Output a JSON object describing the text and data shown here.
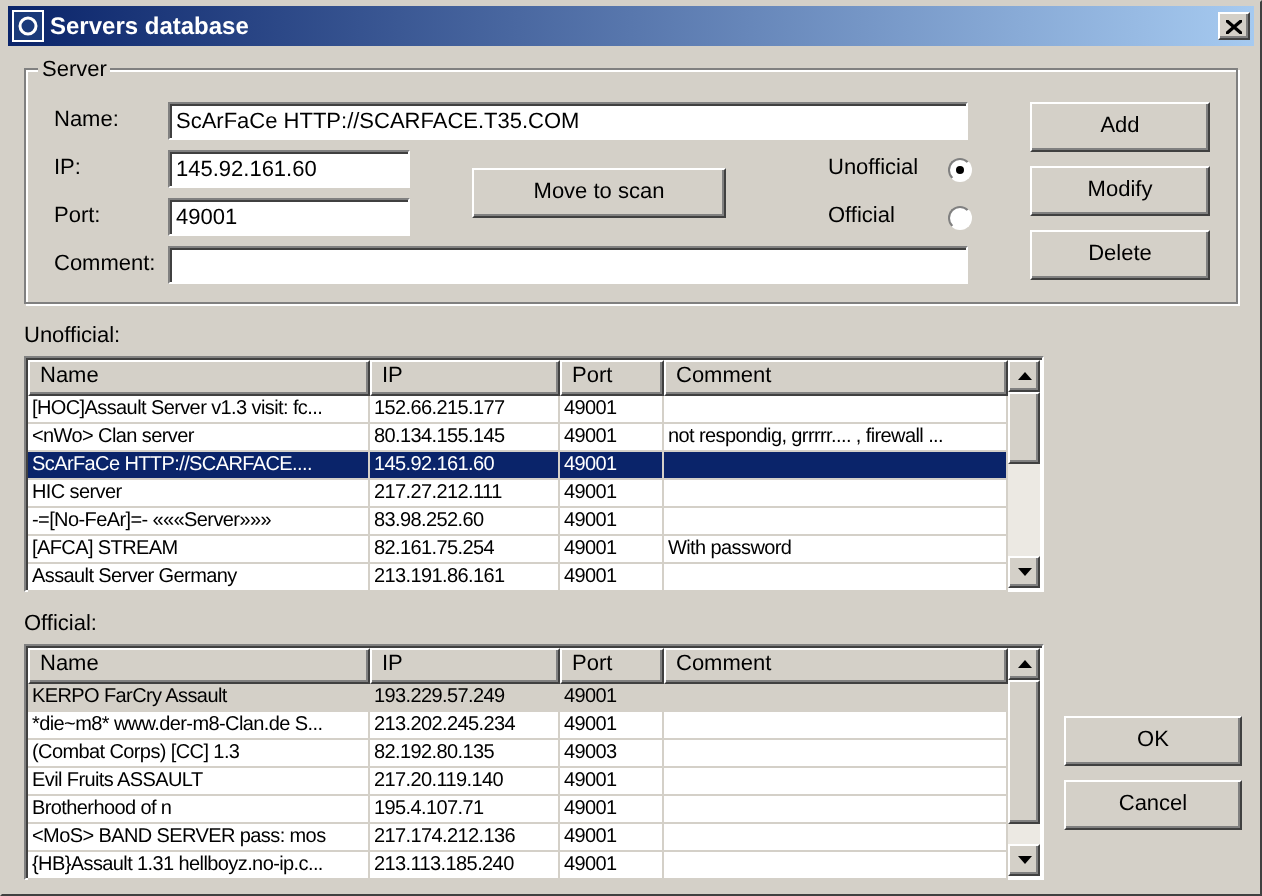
{
  "window": {
    "title": "Servers database"
  },
  "server": {
    "legend": "Server",
    "name_label": "Name:",
    "name_value": "ScArFaCe HTTP://SCARFACE.T35.COM",
    "ip_label": "IP:",
    "ip_value": "145.92.161.60",
    "port_label": "Port:",
    "port_value": "49001",
    "comment_label": "Comment:",
    "move_button": "Move to scan",
    "types": [
      {
        "label": "Unofficial",
        "selected": true
      },
      {
        "label": "Official",
        "selected": false
      }
    ]
  },
  "side_buttons": [
    "Add",
    "Modify",
    "Delete"
  ],
  "lists": [
    {
      "label": "Unofficial:",
      "columns": [
        "Name",
        "IP",
        "Port",
        "Comment"
      ],
      "focused": true,
      "rows": [
        {
          "cells": [
            "[HOC]Assault Server v1.3 visit: fc...",
            "152.66.215.177",
            "49001",
            ""
          ],
          "selected": false
        },
        {
          "cells": [
            "<nWo> Clan server",
            "80.134.155.145",
            "49001",
            "not respondig, grrrrr.... , firewall ..."
          ],
          "selected": false
        },
        {
          "cells": [
            "ScArFaCe HTTP://SCARFACE....",
            "145.92.161.60",
            "49001",
            ""
          ],
          "selected": true
        },
        {
          "cells": [
            "HIC server",
            "217.27.212.111",
            "49001",
            ""
          ],
          "selected": false
        },
        {
          "cells": [
            "-=[No-FeAr]=- «««Server»»»",
            "83.98.252.60",
            "49001",
            ""
          ],
          "selected": false
        },
        {
          "cells": [
            "[AFCA] STREAM",
            "82.161.75.254",
            "49001",
            "With password"
          ],
          "selected": false
        },
        {
          "cells": [
            "Assault Server Germany",
            "213.191.86.161",
            "49001",
            ""
          ],
          "selected": false
        }
      ]
    },
    {
      "label": "Official:",
      "columns": [
        "Name",
        "IP",
        "Port",
        "Comment"
      ],
      "focused": false,
      "rows": [
        {
          "cells": [
            "KERPO FarCry Assault",
            "193.229.57.249",
            "49001",
            ""
          ],
          "selected": true
        },
        {
          "cells": [
            "*die~m8* www.der-m8-Clan.de  S...",
            "213.202.245.234",
            "49001",
            ""
          ],
          "selected": false
        },
        {
          "cells": [
            "(Combat Corps)  [CC]   1.3",
            "82.192.80.135",
            "49003",
            ""
          ],
          "selected": false
        },
        {
          "cells": [
            "Evil Fruits ASSAULT",
            "217.20.119.140",
            "49001",
            ""
          ],
          "selected": false
        },
        {
          "cells": [
            "Brotherhood of n",
            "195.4.107.71",
            "49001",
            ""
          ],
          "selected": false
        },
        {
          "cells": [
            "<MoS> BAND SERVER  pass: mos",
            "217.174.212.136",
            "49001",
            ""
          ],
          "selected": false
        },
        {
          "cells": [
            "{HB}Assault 1.31 hellboyz.no-ip.c...",
            "213.113.185.240",
            "49001",
            ""
          ],
          "selected": false
        }
      ]
    }
  ],
  "dialog_buttons": [
    "OK",
    "Cancel"
  ]
}
